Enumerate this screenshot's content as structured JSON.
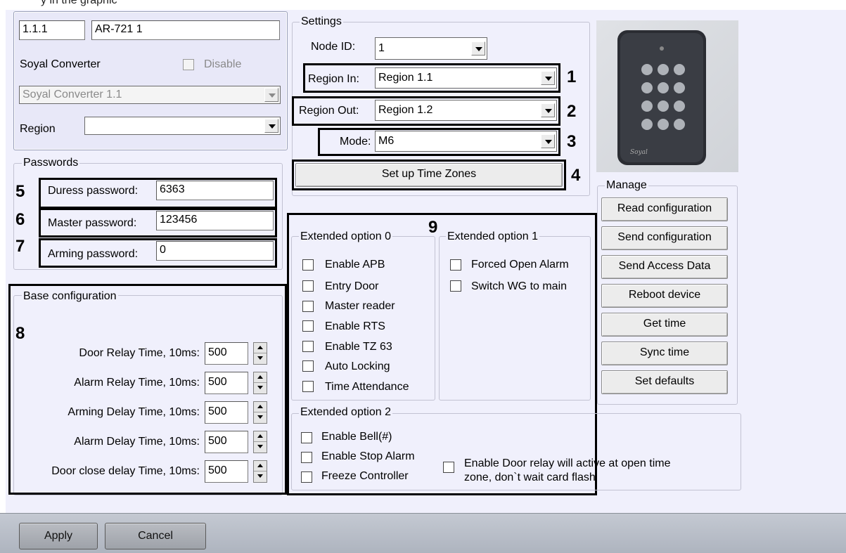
{
  "top_caption": "y in the graphic",
  "device": {
    "address": "1.1.1",
    "name": "AR-721 1",
    "converter_label": "Soyal Converter",
    "disable_label": "Disable",
    "converter_value": "Soyal Converter 1.1",
    "region_label": "Region",
    "region_value": ""
  },
  "passwords": {
    "title": "Passwords",
    "duress_label": "Duress password:",
    "duress_value": "6363",
    "master_label": "Master password:",
    "master_value": "123456",
    "arming_label": "Arming password:",
    "arming_value": "0"
  },
  "base": {
    "title": "Base configuration",
    "rows": [
      {
        "label": "Door Relay Time, 10ms:",
        "value": "500"
      },
      {
        "label": "Alarm Relay Time, 10ms:",
        "value": "500"
      },
      {
        "label": "Arming Delay Time, 10ms:",
        "value": "500"
      },
      {
        "label": "Alarm Delay Time, 10ms:",
        "value": "500"
      },
      {
        "label": "Door close delay Time, 10ms:",
        "value": "500"
      }
    ]
  },
  "settings": {
    "title": "Settings",
    "node_label": "Node ID:",
    "node_value": "1",
    "region_in_label": "Region In:",
    "region_in_value": "Region 1.1",
    "region_out_label": "Region Out:",
    "region_out_value": "Region 1.2",
    "mode_label": "Mode:",
    "mode_value": "M6",
    "timezones_button": "Set up Time Zones"
  },
  "ext0": {
    "title": "Extended option 0",
    "items": [
      "Enable APB",
      "Entry Door",
      "Master reader",
      "Enable RTS",
      "Enable TZ 63",
      "Auto Locking",
      "Time Attendance"
    ]
  },
  "ext1": {
    "title": "Extended option 1",
    "items": [
      "Forced Open Alarm",
      "Switch WG to main"
    ]
  },
  "ext2": {
    "title": "Extended option 2",
    "items": [
      "Enable Bell(#)",
      "Enable Stop Alarm",
      "Freeze Controller"
    ],
    "door_relay_line1": "Enable Door relay will active at open time",
    "door_relay_line2": "zone, don`t wait card flash"
  },
  "manage": {
    "title": "Manage",
    "buttons": [
      "Read configuration",
      "Send configuration",
      "Send Access Data",
      "Reboot device",
      "Get time",
      "Sync time",
      "Set defaults"
    ]
  },
  "markers": [
    "1",
    "2",
    "3",
    "4",
    "5",
    "6",
    "7",
    "8",
    "9"
  ],
  "footer": {
    "apply": "Apply",
    "cancel": "Cancel"
  },
  "colors": {
    "panel": "#f0f0fc",
    "footer": "#b4bac4"
  }
}
